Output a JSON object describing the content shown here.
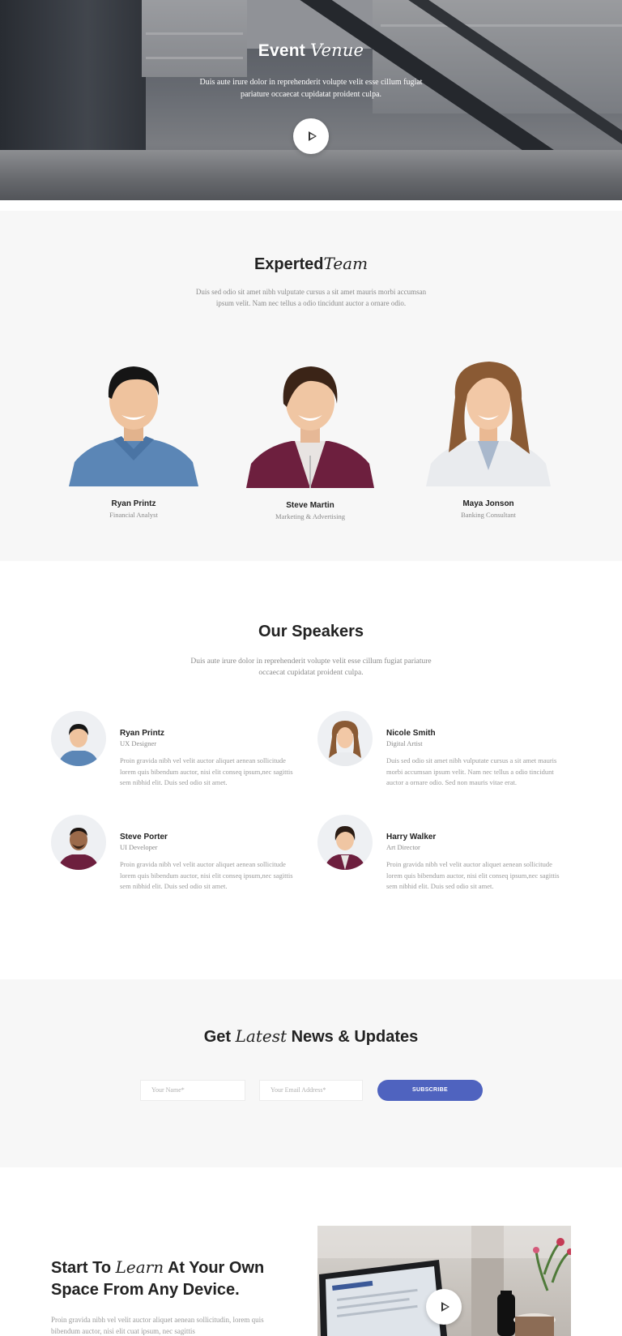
{
  "hero": {
    "title_plain": "Event",
    "title_italic": "Venue",
    "description": "Duis aute irure dolor in reprehenderit volupte velit esse cillum fugiat pariature occaecat cupidatat proident culpa."
  },
  "team": {
    "title_plain": "Experted",
    "title_italic": "Team",
    "description": "Duis sed odio sit amet nibh vulputate cursus a sit amet mauris morbi accumsan ipsum velit. Nam nec tellus a odio tincidunt auctor a ornare odio.",
    "members": [
      {
        "name": "Ryan Printz",
        "role": "Financial Analyst"
      },
      {
        "name": "Steve Martin",
        "role": "Marketing & Advertising"
      },
      {
        "name": "Maya Jonson",
        "role": "Banking Consultant"
      }
    ]
  },
  "speakers": {
    "title": "Our Speakers",
    "description": "Duis aute irure dolor in reprehenderit volupte velit esse cillum fugiat pariature occaecat cupidatat proident culpa.",
    "items": [
      {
        "name": "Ryan Printz",
        "role": "UX Designer",
        "bio": "Proin gravida nibh vel velit auctor aliquet aenean sollicitude lorem quis bibendum auctor, nisi elit conseq ipsum,nec sagittis sem nibhid elit. Duis sed odio sit amet."
      },
      {
        "name": "Nicole Smith",
        "role": "Digital Artist",
        "bio": "Duis sed odio sit amet nibh vulputate cursus a sit amet mauris morbi accumsan ipsum velit. Nam nec tellus a odio tincidunt auctor a ornare odio. Sed non mauris vitae erat."
      },
      {
        "name": "Steve Porter",
        "role": "UI Developer",
        "bio": "Proin gravida nibh vel velit auctor aliquet aenean sollicitude lorem quis bibendum auctor, nisi elit conseq ipsum,nec sagittis sem nibhid elit. Duis sed odio sit amet."
      },
      {
        "name": "Harry Walker",
        "role": "Art Director",
        "bio": "Proin gravida nibh vel velit auctor aliquet aenean sollicitude lorem quis bibendum auctor, nisi elit conseq ipsum,nec sagittis sem nibhid elit. Duis sed odio sit amet."
      }
    ]
  },
  "newsletter": {
    "title_before": "Get",
    "title_italic": "Latest",
    "title_after": "News & Updates",
    "name_placeholder": "Your Name*",
    "email_placeholder": "Your Email Address*",
    "subscribe_label": "SUBSCRIBE"
  },
  "learn": {
    "title_line1_before": "Start To",
    "title_line1_italic": "Learn",
    "title_line1_after": "At Your Own",
    "title_line2": "Space From Any Device.",
    "text": "Proin gravida nibh vel velit auctor aliquet aenean sollicitudin, lorem quis bibendum auctor, nisi elit cuat ipsum, nec sagittis"
  },
  "icons": {
    "play": "play-icon"
  },
  "colors": {
    "accent": "#4f63bf",
    "section_bg": "#f7f7f7",
    "muted_text": "#8a8a8a"
  }
}
